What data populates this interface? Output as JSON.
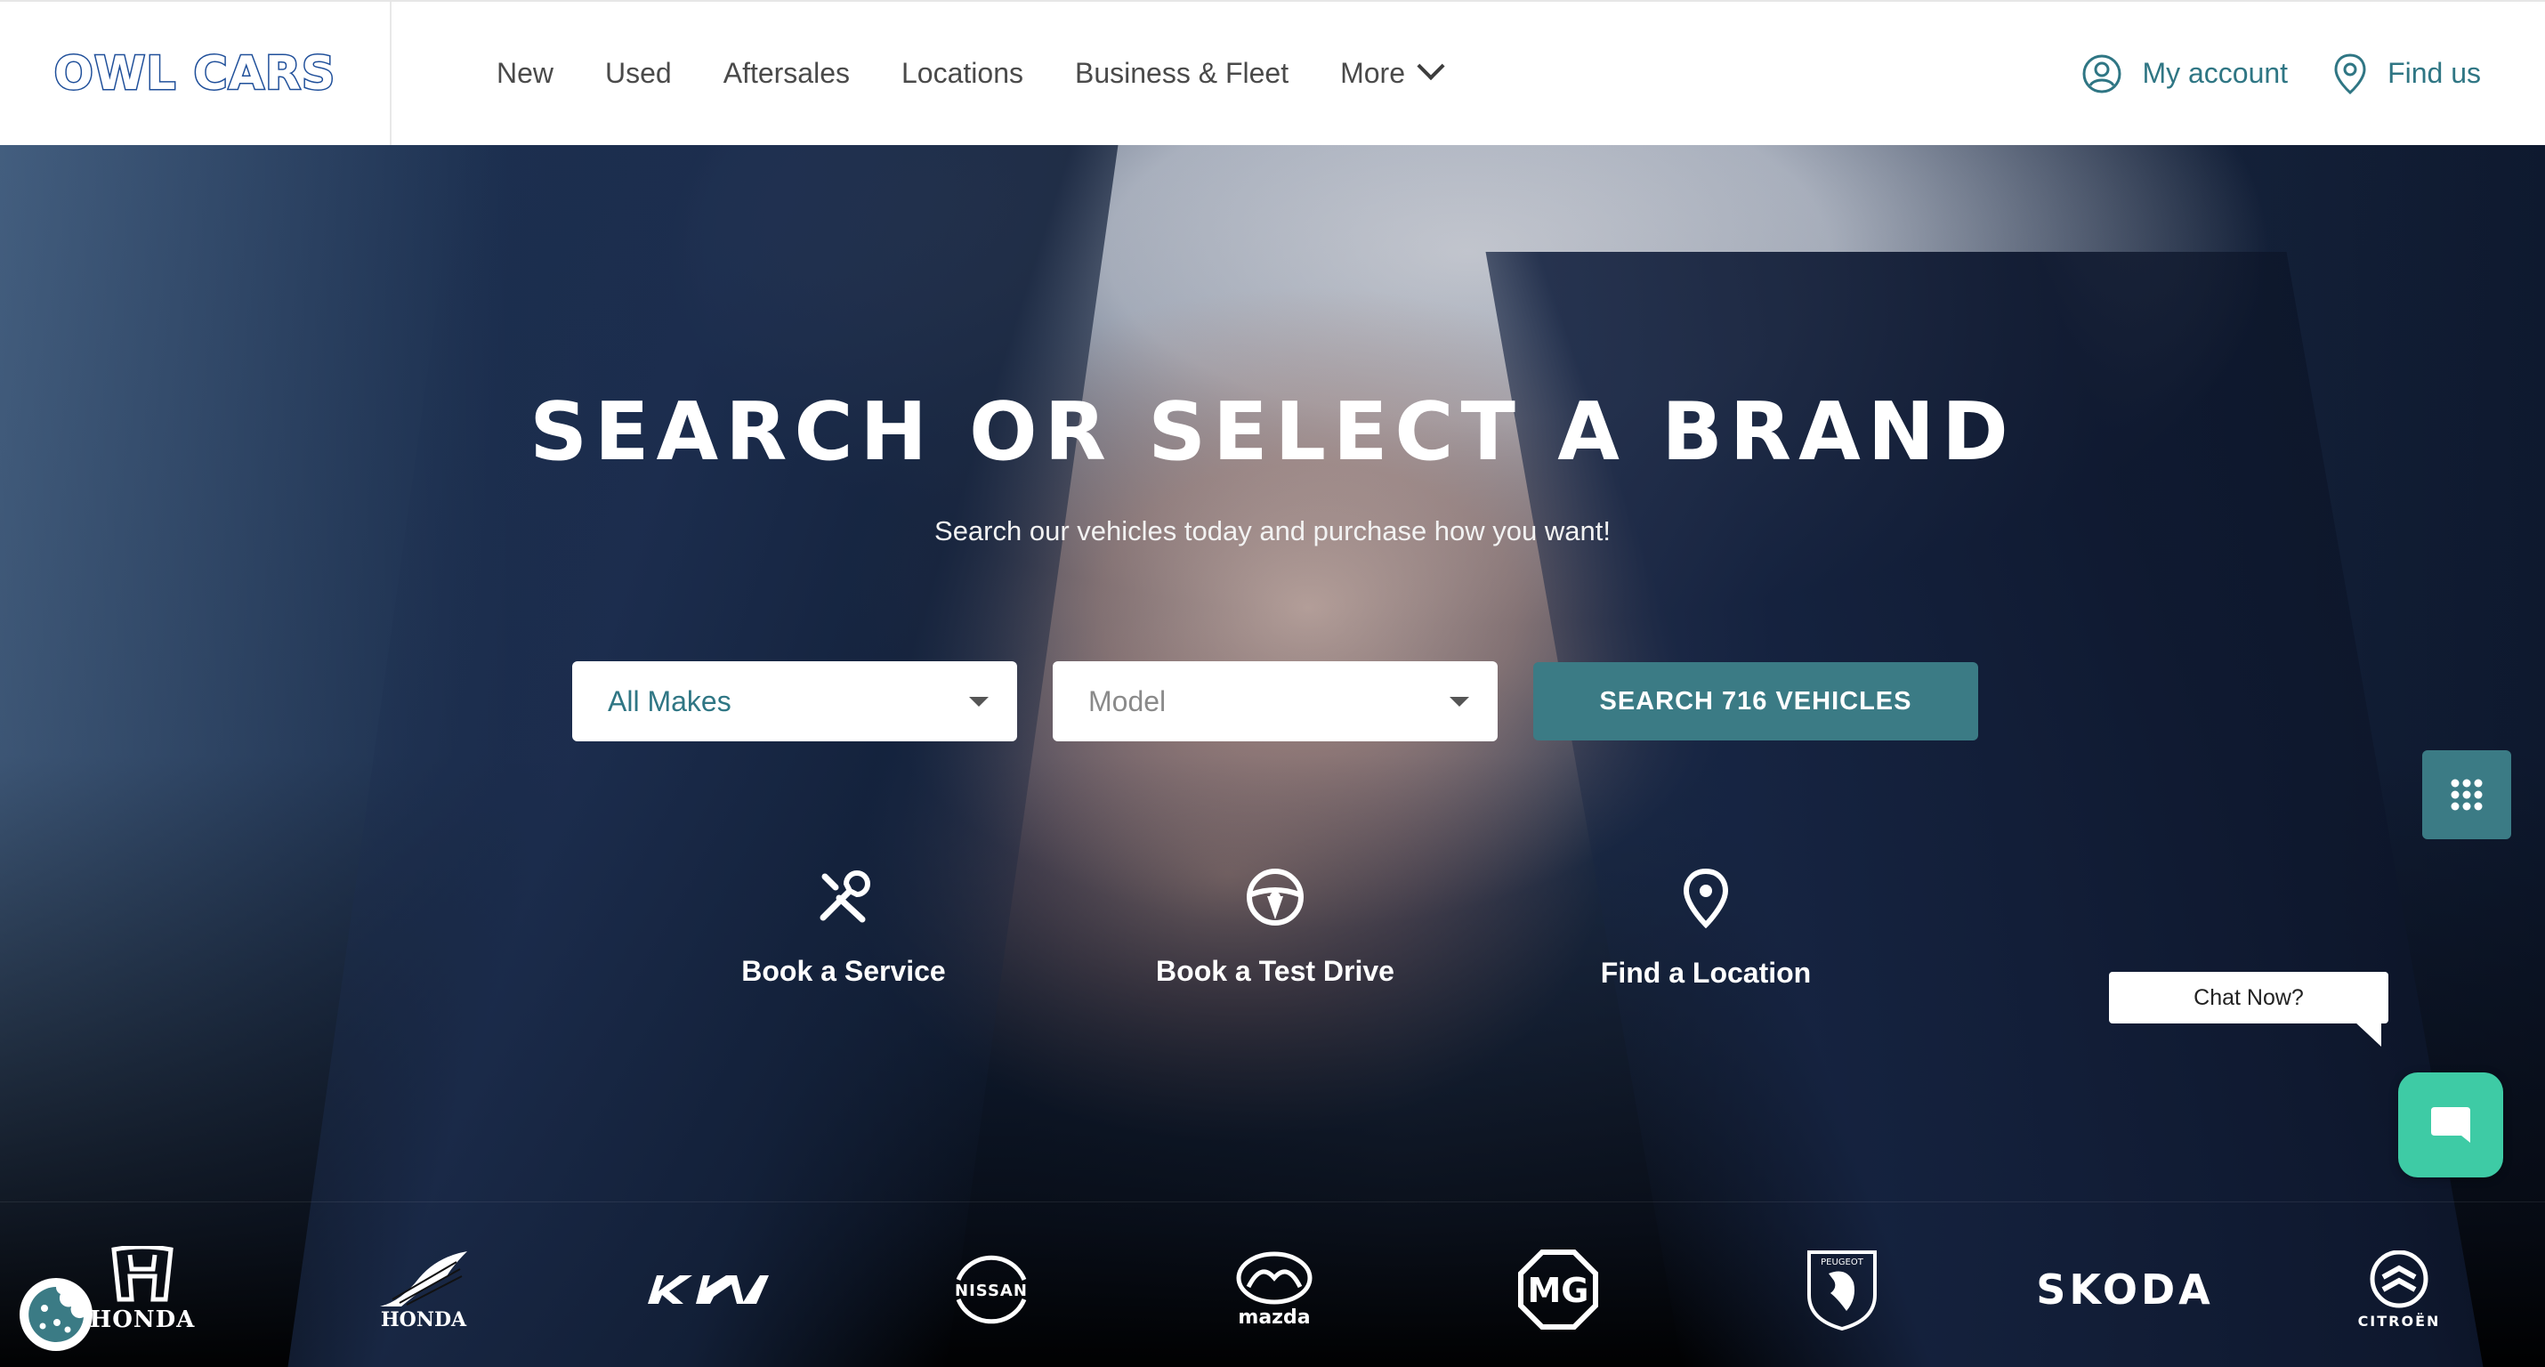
{
  "header": {
    "logo_text": "OWL CARS",
    "nav": [
      {
        "label": "New"
      },
      {
        "label": "Used"
      },
      {
        "label": "Aftersales"
      },
      {
        "label": "Locations"
      },
      {
        "label": "Business & Fleet"
      },
      {
        "label": "More"
      }
    ],
    "my_account": "My account",
    "find_us": "Find us"
  },
  "hero": {
    "title": "SEARCH OR SELECT A BRAND",
    "subtitle": "Search our vehicles today and purchase how you want!",
    "make_select": {
      "value": "All Makes"
    },
    "model_select": {
      "placeholder": "Model"
    },
    "search_button": "SEARCH 716 VEHICLES",
    "quick_links": [
      {
        "label": "Book a Service",
        "icon": "tools-icon"
      },
      {
        "label": "Book a Test Drive",
        "icon": "steering-wheel-icon"
      },
      {
        "label": "Find a Location",
        "icon": "location-pin-icon"
      }
    ]
  },
  "brands": [
    {
      "name": "HONDA",
      "icon": "honda-logo"
    },
    {
      "name": "HONDA",
      "icon": "honda-motorcycles-logo"
    },
    {
      "name": "KIA",
      "icon": "kia-logo"
    },
    {
      "name": "NISSAN",
      "icon": "nissan-logo"
    },
    {
      "name": "mazda",
      "icon": "mazda-logo"
    },
    {
      "name": "MG",
      "icon": "mg-logo"
    },
    {
      "name": "PEUGEOT",
      "icon": "peugeot-logo"
    },
    {
      "name": "SKODA",
      "icon": "skoda-logo"
    },
    {
      "name": "CITROËN",
      "icon": "citroen-logo"
    }
  ],
  "chat": {
    "bubble_text": "Chat Now?"
  },
  "colors": {
    "accent": "#3b7b85",
    "link": "#2f7684",
    "logo": "#1f4f9a",
    "chat": "#3ecba5"
  }
}
